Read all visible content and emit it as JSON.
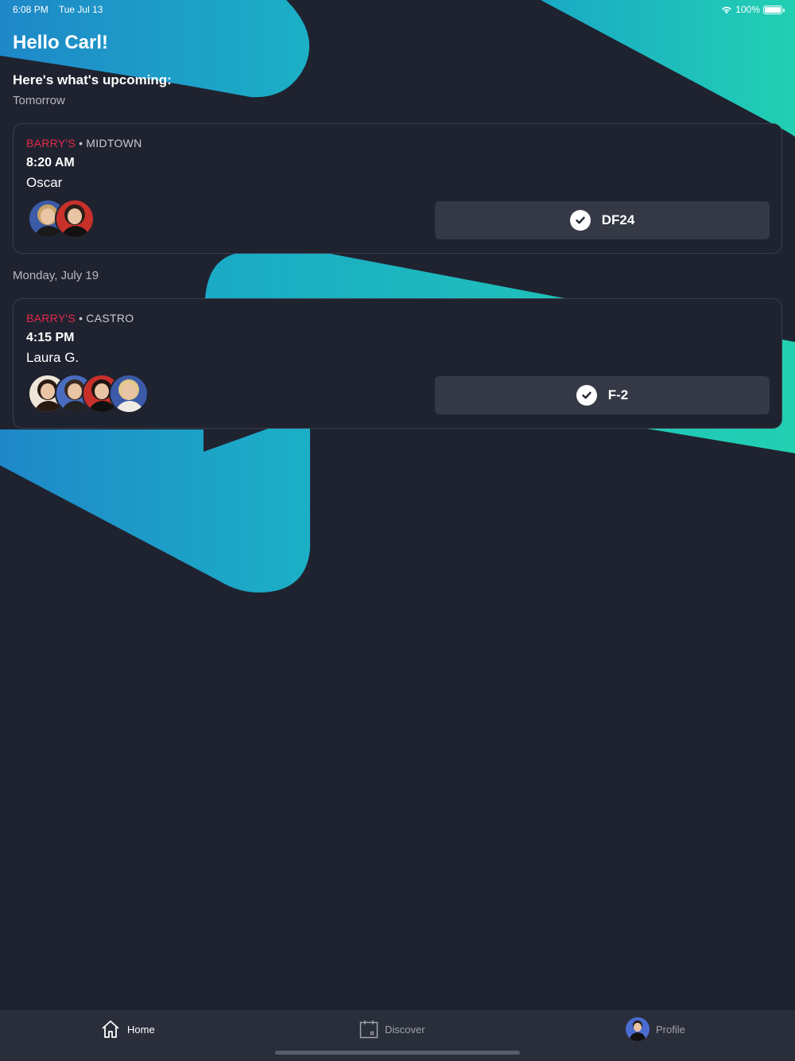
{
  "status_bar": {
    "time": "6:08 PM",
    "date": "Tue Jul 13",
    "battery": "100%"
  },
  "greeting": "Hello Carl!",
  "subheading": "Here's what's upcoming:",
  "sections": [
    {
      "label": "Tomorrow",
      "booking": {
        "brand": "BARRY'S",
        "separator": "•",
        "location": "MIDTOWN",
        "time": "8:20 AM",
        "instructor": "Oscar",
        "spot": "DF24",
        "attendee_count": 2
      }
    },
    {
      "label": "Monday, July 19",
      "booking": {
        "brand": "BARRY'S",
        "separator": "•",
        "location": "CASTRO",
        "time": "4:15 PM",
        "instructor": "Laura G.",
        "spot": "F-2",
        "attendee_count": 4
      }
    }
  ],
  "tabs": {
    "home": "Home",
    "discover": "Discover",
    "profile": "Profile"
  },
  "colors": {
    "background": "#1f2330",
    "brand_red": "#e6294b",
    "teal": "#22c9b4",
    "blue": "#1a94cc"
  },
  "icons": [
    "wifi-icon",
    "battery-icon",
    "check-icon",
    "home-icon",
    "calendar-icon"
  ]
}
